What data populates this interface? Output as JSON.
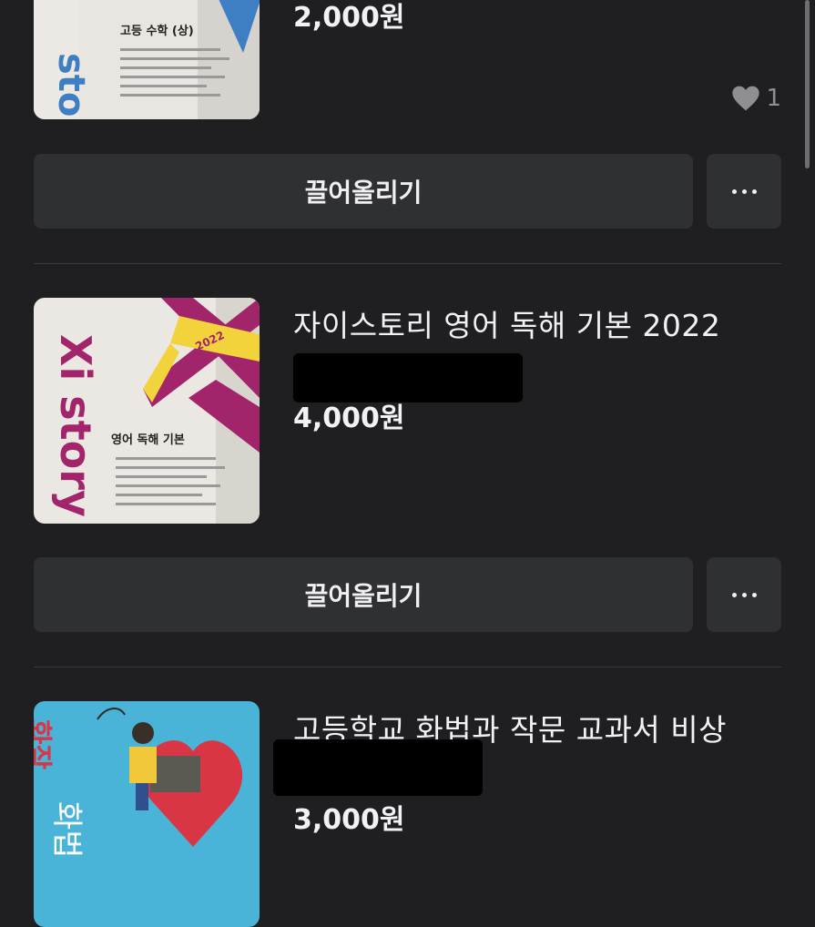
{
  "listings": [
    {
      "title": "",
      "price": "2,000원",
      "likes": "1",
      "bump_label": "끌어올리기",
      "cover_text": "고등 수학 (상)"
    },
    {
      "title": "자이스토리 영어 독해 기본 2022",
      "price": "4,000원",
      "bump_label": "끌어올리기",
      "cover_text": "영어 독해 기본",
      "cover_brand": "Xi story",
      "cover_year": "2022"
    },
    {
      "title": "고등학교 화법과 작문 교과서 비상",
      "price": "3,000원",
      "cover_text": "화법"
    }
  ],
  "colors": {
    "background": "#1f1f22",
    "button": "#2f3033",
    "text": "#f2f2f4",
    "muted": "#8e8e93",
    "cover_magenta": "#a2246a",
    "cover_yellow": "#f2d33b",
    "cover_blue": "#4ab3d8"
  },
  "icons": {
    "like": "heart-icon",
    "more": "more-horizontal-icon"
  }
}
